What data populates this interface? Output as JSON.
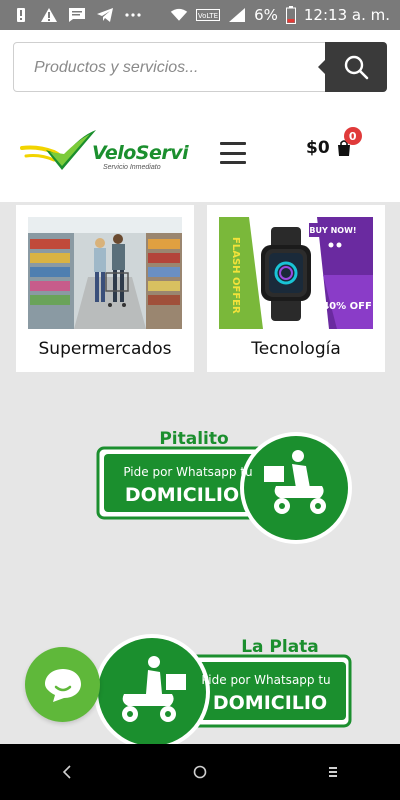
{
  "statusbar": {
    "battery_percent": "6%",
    "time": "12:13 a. m.",
    "icons": [
      "alert-icon",
      "warning-icon",
      "message-icon",
      "telegram-icon",
      "more-icon",
      "wifi-icon",
      "volte-icon",
      "signal-icon",
      "battery-icon"
    ]
  },
  "search": {
    "placeholder": "Productos y servicios...",
    "value": ""
  },
  "logo": {
    "name": "VeloServi",
    "tagline": "Servicio Inmediato"
  },
  "cart": {
    "total": "$0",
    "count": "0"
  },
  "categories": [
    {
      "label": "Supermercados"
    },
    {
      "label": "Tecnología"
    }
  ],
  "tech_image": {
    "buy_now": "BUY NOW!",
    "flash_offer": "FLASH OFFER",
    "discount": "40% OFF"
  },
  "promos": [
    {
      "city": "Pitalito",
      "line1": "Pide por Whatsapp tu",
      "line2": "DOMICILIO"
    },
    {
      "city": "La Plata",
      "line1": "Pide por Whatsapp tu",
      "line2": "DOMICILIO"
    }
  ],
  "colors": {
    "brand_green": "#1b8f2e",
    "brand_yellow": "#f2d400",
    "chat_green": "#5fb83a",
    "header_bg": "#ffffff",
    "page_bg": "#e6e6e6",
    "badge_red": "#e03a3a"
  }
}
